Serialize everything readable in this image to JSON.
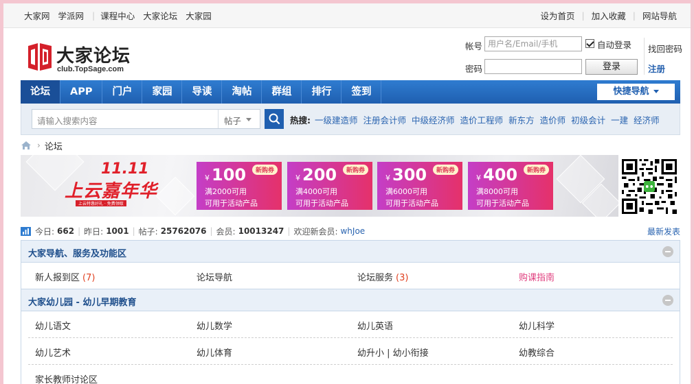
{
  "topbar": {
    "left_links": [
      "大家网",
      "学派网",
      "课程中心",
      "大家论坛",
      "大家园"
    ],
    "right_links": [
      "设为首页",
      "加入收藏",
      "网站导航"
    ]
  },
  "logo": {
    "name": "大家论坛",
    "sub": "club.TopSage.com"
  },
  "login": {
    "account_label": "帐号",
    "account_placeholder": "用户名/Email/手机",
    "password_label": "密码",
    "auto_login": "自动登录",
    "login_button": "登录",
    "find_password": "找回密码",
    "register": "注册"
  },
  "nav": {
    "items": [
      "论坛",
      "APP",
      "门户",
      "家园",
      "导读",
      "淘帖",
      "群组",
      "排行",
      "签到"
    ],
    "active_index": 0,
    "quick_nav": "快捷导航"
  },
  "search": {
    "placeholder": "请输入搜索内容",
    "scope": "帖子",
    "hot_label": "热搜:",
    "hot_keywords": [
      "一级建造师",
      "注册会计师",
      "中级经济师",
      "造价工程师",
      "新东方",
      "造价师",
      "初级会计",
      "一建",
      "经济师"
    ]
  },
  "breadcrumb": {
    "current": "论坛"
  },
  "banner": {
    "title_top": "11.11",
    "title_main": "上云嘉年华",
    "tagline": "上云特惠好礼 · 免费领取",
    "coupons": [
      {
        "amount": "100",
        "tag": "新购券",
        "line1": "满2000可用",
        "line2": "可用于活动产品"
      },
      {
        "amount": "200",
        "tag": "新购券",
        "line1": "满4000可用",
        "line2": "可用于活动产品"
      },
      {
        "amount": "300",
        "tag": "新购券",
        "line1": "满6000可用",
        "line2": "可用于活动产品"
      },
      {
        "amount": "400",
        "tag": "新购券",
        "line1": "满8000可用",
        "line2": "可用于活动产品"
      }
    ],
    "currency": "¥"
  },
  "stats": {
    "today_label": "今日:",
    "today": "662",
    "yesterday_label": "昨日:",
    "yesterday": "1001",
    "posts_label": "帖子:",
    "posts": "25762076",
    "members_label": "会员:",
    "members": "10013247",
    "welcome_label": "欢迎新会员:",
    "newest_member": "whJoe",
    "latest_posts": "最新发表"
  },
  "categories": [
    {
      "title": "大家导航、服务及功能区",
      "rows": [
        [
          {
            "name": "新人报到区",
            "count": "(7)"
          },
          {
            "name": "论坛导航",
            "count": ""
          },
          {
            "name": "论坛服务",
            "count": "(3)"
          },
          {
            "name": "购课指南",
            "count": "",
            "highlight": true
          }
        ]
      ]
    },
    {
      "title": "大家幼儿园 - 幼儿早期教育",
      "rows": [
        [
          {
            "name": "幼儿语文",
            "count": ""
          },
          {
            "name": "幼儿数学",
            "count": ""
          },
          {
            "name": "幼儿英语",
            "count": ""
          },
          {
            "name": "幼儿科学",
            "count": ""
          }
        ],
        [
          {
            "name": "幼儿艺术",
            "count": ""
          },
          {
            "name": "幼儿体育",
            "count": ""
          },
          {
            "name": "幼升小 | 幼小衔接",
            "count": ""
          },
          {
            "name": "幼教综合",
            "count": ""
          }
        ],
        [
          {
            "name": "家长教师讨论区",
            "count": ""
          }
        ]
      ]
    }
  ],
  "colors": {
    "nav_blue": "#1f5fb0",
    "link_blue": "#2a64b0",
    "count_red": "#e0401f",
    "highlight_pink": "#e0407f",
    "outer_border": "#f4c6d0"
  }
}
